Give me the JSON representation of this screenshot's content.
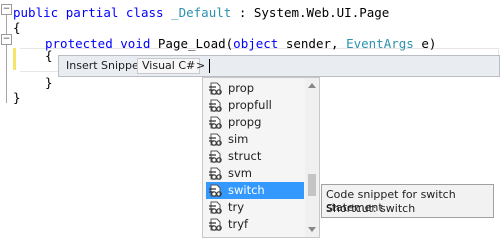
{
  "code": {
    "line1": {
      "kw1": "public",
      "kw2": "partial",
      "kw3": "class",
      "classname": "_Default",
      "rest": " : System.Web.UI.Page"
    },
    "line2": "{",
    "line3": {
      "kw1": "protected",
      "kw2": "void",
      "method": " Page_Load(",
      "kw3": "object",
      "p1": " sender, ",
      "type": "EventArgs",
      "p2": " e)"
    },
    "line4": "{",
    "line5": "}",
    "line6": "}",
    "fold_minus": "−"
  },
  "snippet_bar": {
    "label": "Insert Snippet:",
    "tag": "Visual C#",
    "separator": ">"
  },
  "snippet_list": {
    "items": [
      {
        "label": "prop"
      },
      {
        "label": "propfull"
      },
      {
        "label": "propg"
      },
      {
        "label": "sim"
      },
      {
        "label": "struct"
      },
      {
        "label": "svm"
      },
      {
        "label": "switch",
        "selected": true
      },
      {
        "label": "try"
      },
      {
        "label": "tryf"
      }
    ],
    "icon": "snippet-icon"
  },
  "tooltip": {
    "line1": "Code snippet for switch statement",
    "line2": "Shortcut: switch"
  },
  "colors": {
    "keyword": "#0000ff",
    "type": "#2b91af",
    "selection": "#3399ff"
  }
}
